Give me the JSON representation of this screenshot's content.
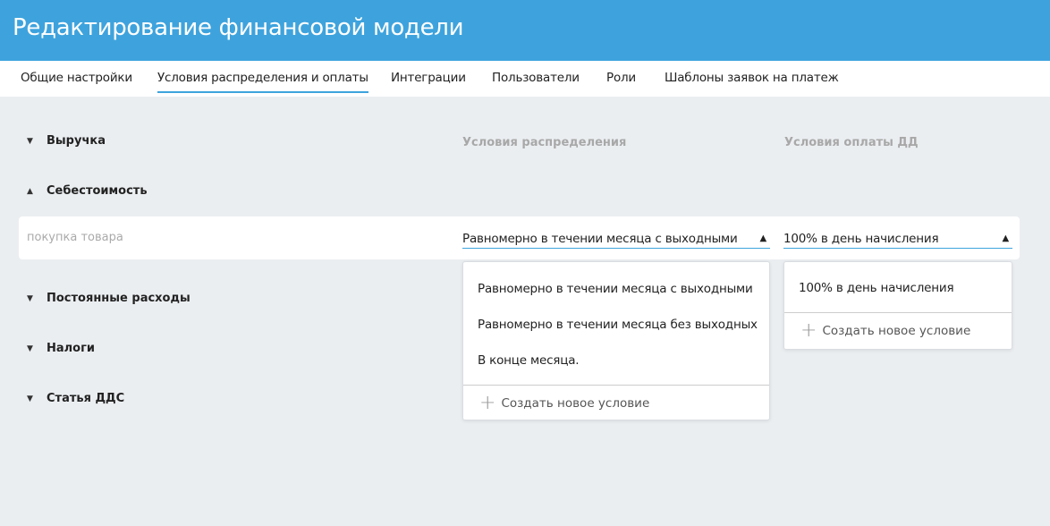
{
  "header": {
    "title": "Редактирование финансовой модели"
  },
  "tabs": [
    "Общие настройки",
    "Условия распределения и оплаты",
    "Интеграции",
    "Пользователи",
    "Роли",
    "Шаблоны заявок на платеж"
  ],
  "columns": {
    "distribution": "Условия распределения",
    "payment": "Условия оплаты ДД"
  },
  "sections": [
    "Выручка",
    "Себестоимость",
    "Постоянные расходы",
    "Налоги",
    "Статья ДДС"
  ],
  "row": {
    "name_placeholder": "покупка товара",
    "distribution": "Равномерно в течении месяца с выходными",
    "payment": "100% в день начисления"
  },
  "distribution_options": [
    "Равномерно в течении месяца с выходными",
    "Равномерно в течении месяца без выходных",
    "В конце месяца."
  ],
  "payment_options": [
    "100% в день начисления"
  ],
  "create_label": "Создать новое условие",
  "colors": {
    "accent": "#3ea3dd",
    "background": "#ebeef1"
  }
}
